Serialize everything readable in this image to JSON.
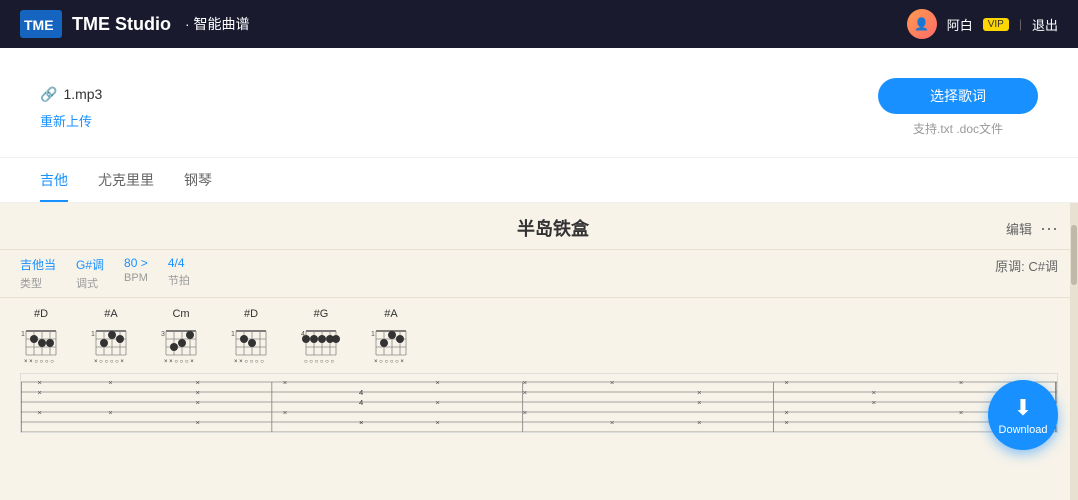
{
  "header": {
    "logo_text": "TME",
    "title": "TME Studio",
    "subtitle": "· 智能曲谱",
    "user_name": "阿白",
    "user_vip": "VIP",
    "logout_label": "退出"
  },
  "upload": {
    "file_name": "1.mp3",
    "reupload_label": "重新上传",
    "select_lyrics_label": "选择歌词",
    "support_text": "支持.txt .doc文件"
  },
  "tabs": [
    {
      "id": "guitar",
      "label": "吉他",
      "active": true
    },
    {
      "id": "ukulele",
      "label": "尤克里里",
      "active": false
    },
    {
      "id": "piano",
      "label": "钢琴",
      "active": false
    }
  ],
  "sheet": {
    "title": "半岛铁盒",
    "edit_label": "编辑",
    "meta": {
      "guitar_type_value": "吉他当",
      "guitar_type_label": "类型",
      "key_value": "G#调",
      "key_label": "调式",
      "bpm_value": "80 >",
      "bpm_label": "BPM",
      "time_value": "4/4",
      "time_label": "节拍"
    },
    "original_key": "原调: C#调",
    "chords": [
      {
        "name": "#D",
        "fret": 1
      },
      {
        "name": "#A",
        "fret": 1
      },
      {
        "name": "Cm",
        "fret": 3
      },
      {
        "name": "#D",
        "fret": 1
      },
      {
        "name": "#G",
        "fret": 4
      },
      {
        "name": "#A",
        "fret": 1
      }
    ]
  },
  "download_button": {
    "label": "Download",
    "icon": "↓"
  }
}
